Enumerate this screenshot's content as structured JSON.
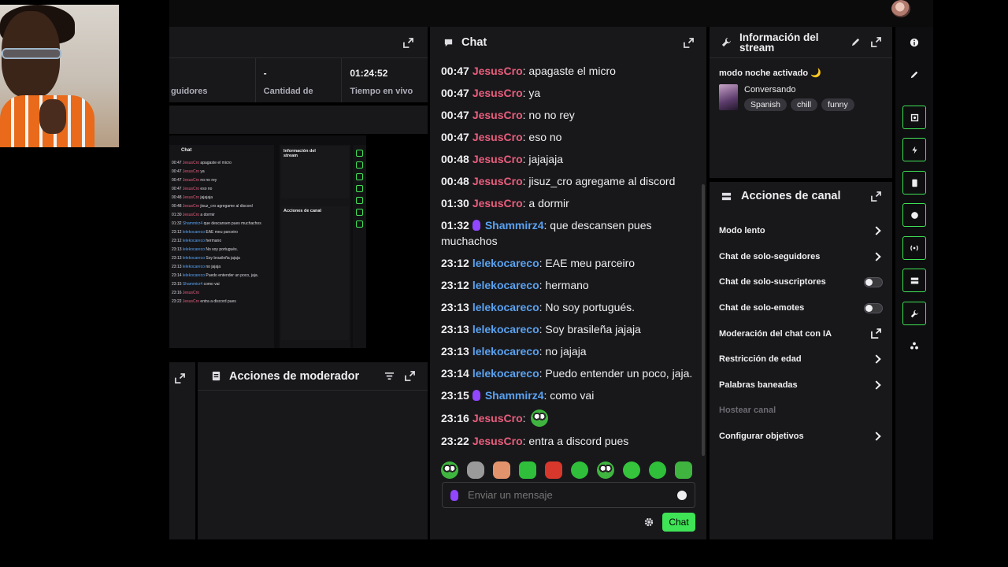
{
  "stats": {
    "followers_label": "guidores",
    "subs_value": "-",
    "subs_label": "Cantidad de",
    "uptime_value": "01:24:52",
    "uptime_label": "Tiempo en vivo"
  },
  "chat": {
    "title": "Chat",
    "input_placeholder": "Enviar un mensaje",
    "send_label": "Chat",
    "messages": [
      {
        "time": "00:47",
        "user": "JesusCro",
        "color": "red",
        "badge": false,
        "text": ": apagaste el micro"
      },
      {
        "time": "00:47",
        "user": "JesusCro",
        "color": "red",
        "badge": false,
        "text": ": ya"
      },
      {
        "time": "00:47",
        "user": "JesusCro",
        "color": "red",
        "badge": false,
        "text": ": no no rey"
      },
      {
        "time": "00:47",
        "user": "JesusCro",
        "color": "red",
        "badge": false,
        "text": ": eso no"
      },
      {
        "time": "00:48",
        "user": "JesusCro",
        "color": "red",
        "badge": false,
        "text": ": jajajaja"
      },
      {
        "time": "00:48",
        "user": "JesusCro",
        "color": "red",
        "badge": false,
        "text": ": jisuz_cro agregame al discord"
      },
      {
        "time": "01:30",
        "user": "JesusCro",
        "color": "red",
        "badge": false,
        "text": ": a dormir"
      },
      {
        "time": "01:32",
        "user": "Shammirz4",
        "color": "blue",
        "badge": true,
        "text": ": que descansen pues muchachos"
      },
      {
        "time": "23:12",
        "user": "lelekocareco",
        "color": "blue",
        "badge": false,
        "text": ": EAE meu parceiro"
      },
      {
        "time": "23:12",
        "user": "lelekocareco",
        "color": "blue",
        "badge": false,
        "text": ": hermano"
      },
      {
        "time": "23:13",
        "user": "lelekocareco",
        "color": "blue",
        "badge": false,
        "text": ": No soy portugués."
      },
      {
        "time": "23:13",
        "user": "lelekocareco",
        "color": "blue",
        "badge": false,
        "text": ": Soy brasileña jajaja"
      },
      {
        "time": "23:13",
        "user": "lelekocareco",
        "color": "blue",
        "badge": false,
        "text": ": no jajaja"
      },
      {
        "time": "23:14",
        "user": "lelekocareco",
        "color": "blue",
        "badge": false,
        "text": ": Puedo entender un poco, jaja."
      },
      {
        "time": "23:15",
        "user": "Shammirz4",
        "color": "blue",
        "badge": true,
        "text": ": como vai"
      },
      {
        "time": "23:16",
        "user": "JesusCro",
        "color": "red",
        "badge": false,
        "text": ":",
        "emote": true
      },
      {
        "time": "23:22",
        "user": "JesusCro",
        "color": "red",
        "badge": false,
        "text": ": entra a discord pues"
      }
    ]
  },
  "moderator": {
    "title": "Acciones de moderador"
  },
  "info": {
    "title": "Información del stream",
    "stream_title": "modo noche activado 🌙",
    "category": "Conversando",
    "tags": [
      "Spanish",
      "chill",
      "funny"
    ]
  },
  "actions": {
    "title": "Acciones de canal",
    "items": [
      {
        "label": "Modo lento",
        "control": "chevron"
      },
      {
        "label": "Chat de solo-seguidores",
        "control": "chevron"
      },
      {
        "label": "Chat de solo-suscriptores",
        "control": "toggle"
      },
      {
        "label": "Chat de solo-emotes",
        "control": "toggle"
      },
      {
        "label": "Moderación del chat con IA",
        "control": "external"
      },
      {
        "label": "Restricción de edad",
        "control": "chevron"
      },
      {
        "label": "Palabras baneadas",
        "control": "chevron"
      },
      {
        "label": "Hostear canal",
        "control": "none",
        "disabled": true
      },
      {
        "label": "Configurar objetivos",
        "control": "chevron"
      }
    ]
  },
  "preview": {
    "chat_title": "Chat",
    "info_title": "Información del stream",
    "actions_title": "Acciones de canal",
    "lines": [
      {
        "t": "00:47",
        "u": "JesusCro",
        "c": "u",
        "m": " apagaste el micro"
      },
      {
        "t": "00:47",
        "u": "JesusCro",
        "c": "u",
        "m": " ya"
      },
      {
        "t": "00:47",
        "u": "JesusCro",
        "c": "u",
        "m": " no no rey"
      },
      {
        "t": "00:47",
        "u": "JesusCro",
        "c": "u",
        "m": " eso no"
      },
      {
        "t": "00:48",
        "u": "JesusCro",
        "c": "u",
        "m": " jajajaja"
      },
      {
        "t": "00:48",
        "u": "JesusCro",
        "c": "u",
        "m": " jisuz_cro agregame al discord"
      },
      {
        "t": "01:30",
        "u": "JesusCro",
        "c": "u",
        "m": " a dormir"
      },
      {
        "t": "01:32",
        "u": "Shammirz4",
        "c": "b",
        "m": " que descansen pues muchachos"
      },
      {
        "t": "23:12",
        "u": "lelekocareco",
        "c": "b",
        "m": " EAE meu parceiro"
      },
      {
        "t": "23:12",
        "u": "lelekocareco",
        "c": "b",
        "m": " hermano"
      },
      {
        "t": "23:13",
        "u": "lelekocareco",
        "c": "b",
        "m": " No soy portugués."
      },
      {
        "t": "23:13",
        "u": "lelekocareco",
        "c": "b",
        "m": " Soy brasileña jajaja"
      },
      {
        "t": "23:13",
        "u": "lelekocareco",
        "c": "b",
        "m": " no jajaja"
      },
      {
        "t": "23:14",
        "u": "lelekocareco",
        "c": "b",
        "m": " Puedo entender un poco, jaja."
      },
      {
        "t": "23:15",
        "u": "Shammirz4",
        "c": "b",
        "m": " como vai"
      },
      {
        "t": "23:16",
        "u": "JesusCro",
        "c": "u",
        "m": ""
      },
      {
        "t": "23:22",
        "u": "JesusCro",
        "c": "u",
        "m": " entra a discord pues"
      }
    ]
  },
  "colors": {
    "accent": "#3fe356",
    "user_red": "#eb5e7d",
    "user_blue": "#5aa2f0",
    "panel": "#18181b"
  },
  "icons": {
    "external": "pop-out-icon",
    "edit": "pencil-icon",
    "info": "info-icon",
    "filter": "filter-icon",
    "settings": "gear-icon",
    "emoji": "smiley-icon",
    "mic": "microphone-icon",
    "chat": "chat-bubble-icon"
  }
}
